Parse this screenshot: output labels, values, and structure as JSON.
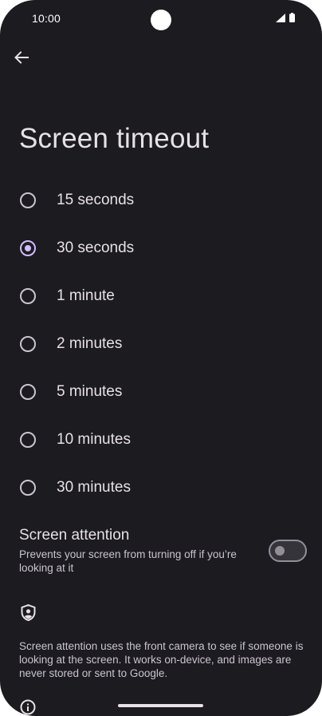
{
  "status_bar": {
    "time": "10:00",
    "icons": [
      "signal-icon",
      "battery-icon"
    ]
  },
  "header": {
    "back_icon": "arrow-back-icon",
    "title": "Screen timeout"
  },
  "timeout_options": [
    {
      "label": "15 seconds",
      "selected": false
    },
    {
      "label": "30 seconds",
      "selected": true
    },
    {
      "label": "1 minute",
      "selected": false
    },
    {
      "label": "2 minutes",
      "selected": false
    },
    {
      "label": "5 minutes",
      "selected": false
    },
    {
      "label": "10 minutes",
      "selected": false
    },
    {
      "label": "30 minutes",
      "selected": false
    }
  ],
  "screen_attention": {
    "title": "Screen attention",
    "subtitle": "Prevents your screen from turning off if you’re looking at it",
    "enabled": false
  },
  "privacy": {
    "icon": "shield-person-icon",
    "text": "Screen attention uses the front camera to see if someone is looking at the screen. It works on-device, and images are never stored or sent to Google."
  },
  "info_icon": "info-icon",
  "colors": {
    "background": "#1c1b1f",
    "text_primary": "#e6e1e5",
    "text_secondary": "#cac4d0",
    "accent": "#d0bcff"
  }
}
